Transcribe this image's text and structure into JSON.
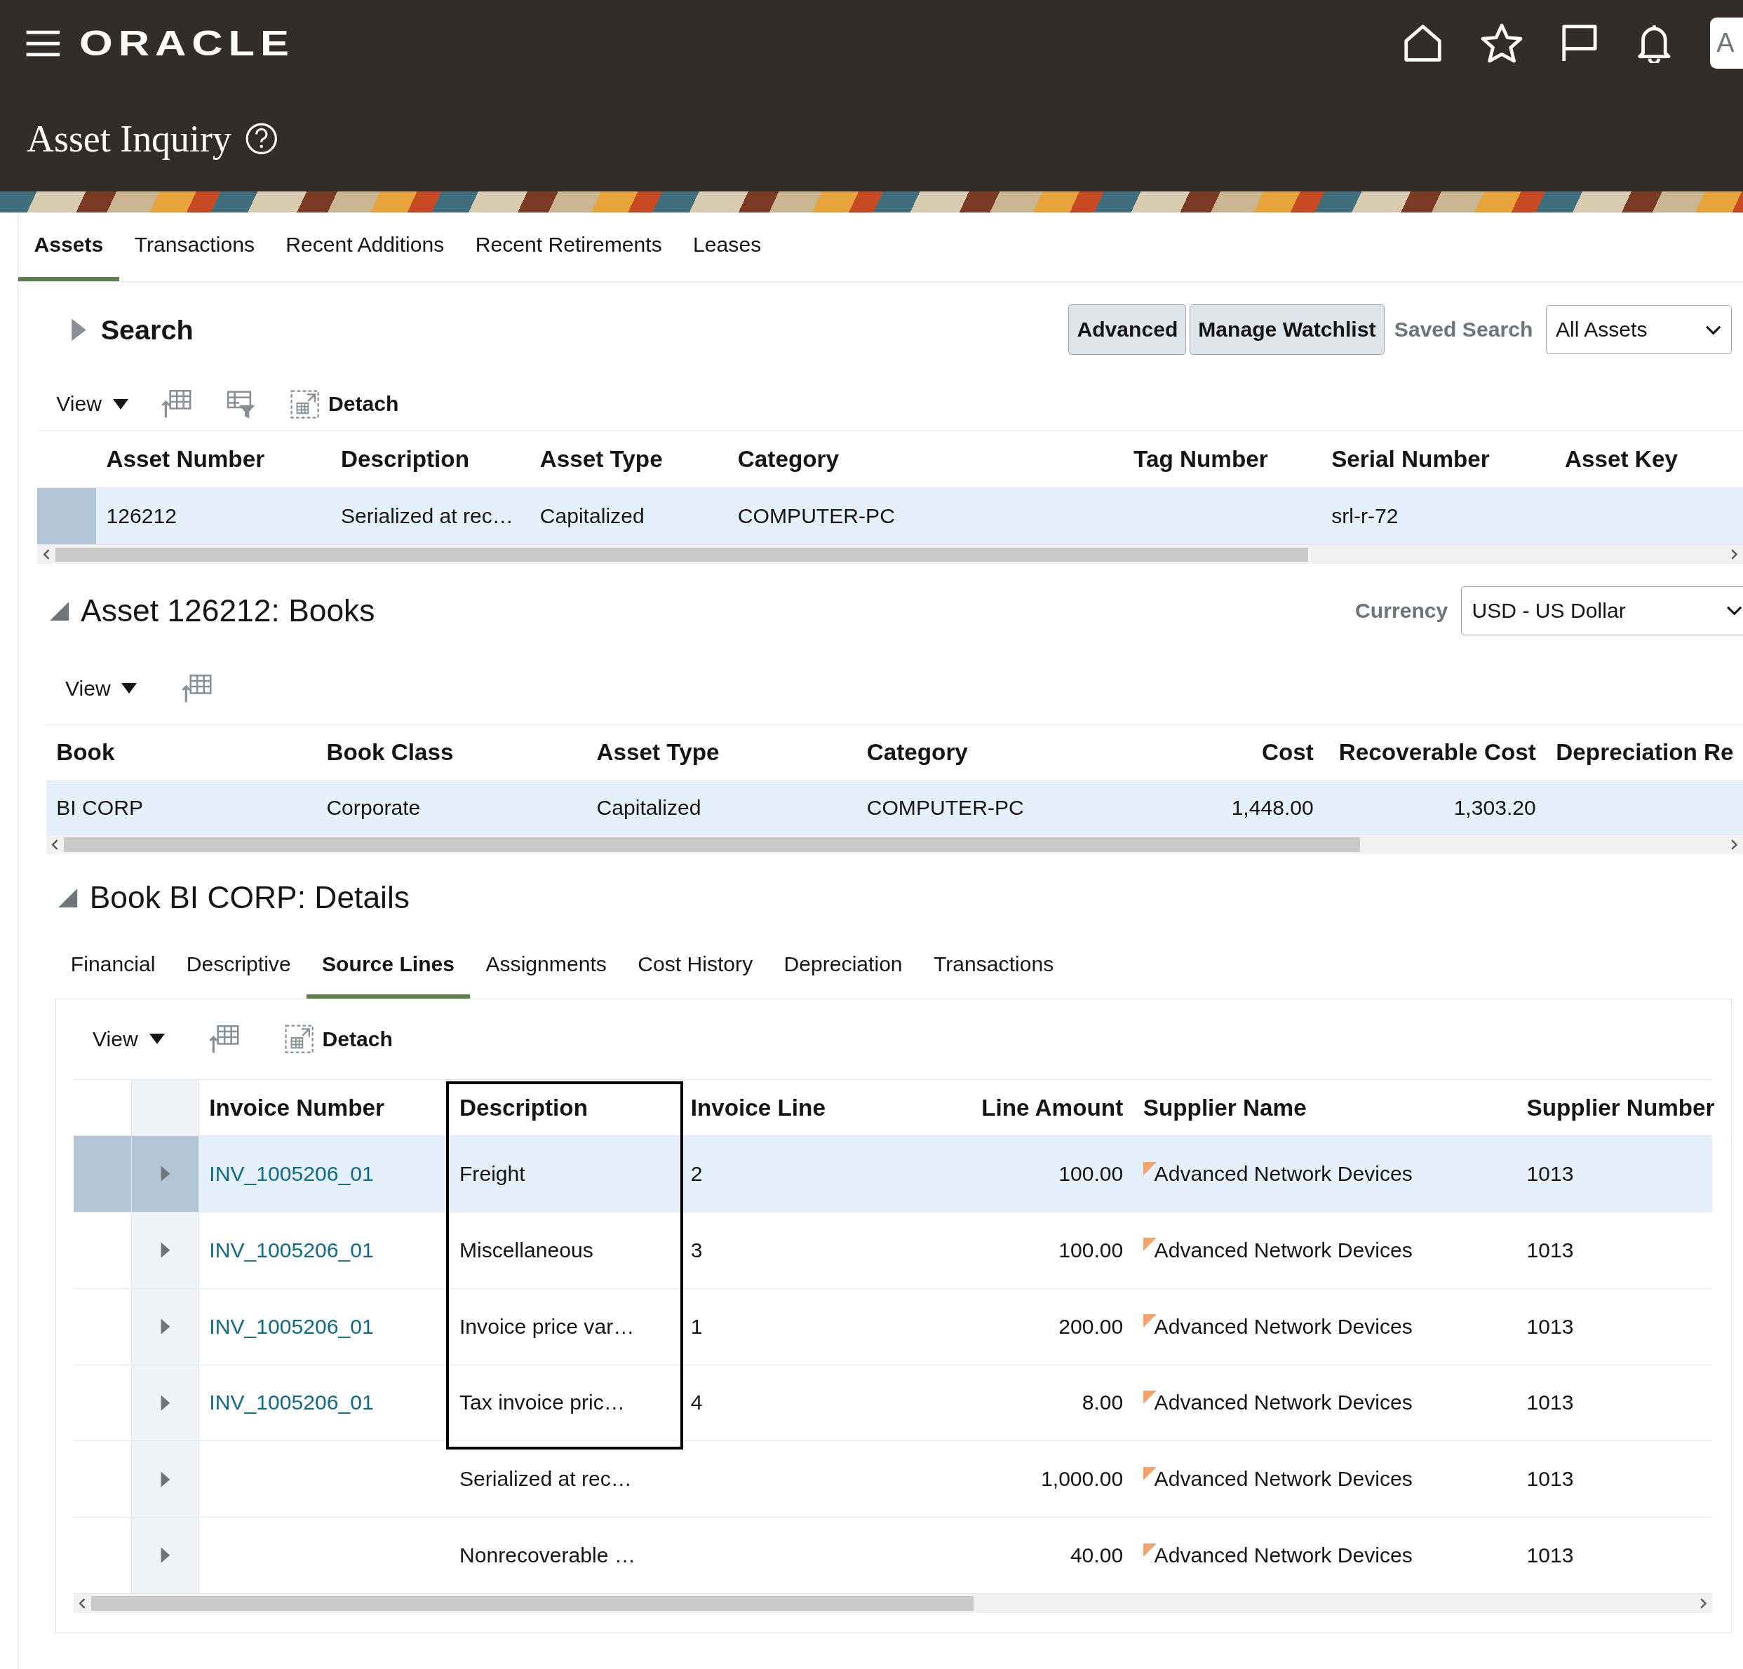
{
  "header": {
    "brand": "ORACLE",
    "avatar": "A",
    "title": "Asset Inquiry"
  },
  "tabs": [
    {
      "label": "Assets",
      "selected": true
    },
    {
      "label": "Transactions",
      "selected": false
    },
    {
      "label": "Recent Additions",
      "selected": false
    },
    {
      "label": "Recent Retirements",
      "selected": false
    },
    {
      "label": "Leases",
      "selected": false
    }
  ],
  "search": {
    "title": "Search",
    "expanded": false,
    "buttons": [
      "Advanced",
      "Manage Watchlist"
    ],
    "saved_search": {
      "label": "Saved Search",
      "value": "All Assets"
    }
  },
  "assets_toolbar": {
    "view": "View",
    "detach": "Detach"
  },
  "assets_table": {
    "columns": [
      "Asset Number",
      "Description",
      "Asset Type",
      "Category",
      "Tag Number",
      "Serial Number",
      "Asset Key"
    ],
    "rows": [
      {
        "selected": true,
        "asset_number": "126212",
        "description": "Serialized at rec…",
        "asset_type": "Capitalized",
        "category": "COMPUTER-PC",
        "serial_number": "srl-r-72"
      }
    ]
  },
  "books": {
    "title": "Asset 126212: Books",
    "expanded": true,
    "currency": {
      "label": "Currency",
      "value": "USD - US Dollar"
    },
    "view": "View",
    "columns": [
      "Book",
      "Book Class",
      "Asset Type",
      "Category",
      "Cost",
      "Recoverable Cost",
      "Depreciation Re"
    ],
    "rows": [
      {
        "selected": true,
        "book": "BI CORP",
        "book_class": "Corporate",
        "asset_type": "Capitalized",
        "category": "COMPUTER-PC",
        "cost": "1,448.00",
        "recoverable_cost": "1,303.20"
      }
    ]
  },
  "details": {
    "title": "Book BI CORP: Details",
    "expanded": true,
    "tabs": [
      {
        "label": "Financial",
        "selected": false
      },
      {
        "label": "Descriptive",
        "selected": false
      },
      {
        "label": "Source Lines",
        "selected": true
      },
      {
        "label": "Assignments",
        "selected": false
      },
      {
        "label": "Cost History",
        "selected": false
      },
      {
        "label": "Depreciation",
        "selected": false
      },
      {
        "label": "Transactions",
        "selected": false
      }
    ],
    "view": "View",
    "detach": "Detach",
    "columns": [
      {
        "label": "Invoice Number",
        "outlined": false
      },
      {
        "label": "Description",
        "outlined": true
      },
      {
        "label": "Invoice Line",
        "outlined": false
      },
      {
        "label": "Line Amount",
        "outlined": false
      },
      {
        "label": "Supplier Name",
        "outlined": false
      },
      {
        "label": "Supplier Number",
        "outlined": false
      }
    ],
    "rows": [
      {
        "selected": true,
        "outlined": true,
        "invoice_number": "INV_1005206_01",
        "description": "Freight",
        "invoice_line": "2",
        "line_amount": "100.00",
        "supplier_name": "Advanced Network Devices",
        "supplier_number": "1013"
      },
      {
        "selected": false,
        "outlined": true,
        "invoice_number": "INV_1005206_01",
        "description": "Miscellaneous",
        "invoice_line": "3",
        "line_amount": "100.00",
        "supplier_name": "Advanced Network Devices",
        "supplier_number": "1013"
      },
      {
        "selected": false,
        "outlined": true,
        "invoice_number": "INV_1005206_01",
        "description": "Invoice price var…",
        "invoice_line": "1",
        "line_amount": "200.00",
        "supplier_name": "Advanced Network Devices",
        "supplier_number": "1013"
      },
      {
        "selected": false,
        "outlined": true,
        "invoice_number": "INV_1005206_01",
        "description": "Tax invoice pric…",
        "invoice_line": "4",
        "line_amount": "8.00",
        "supplier_name": "Advanced Network Devices",
        "supplier_number": "1013"
      },
      {
        "selected": false,
        "outlined": false,
        "description": "Serialized at rec…",
        "line_amount": "1,000.00",
        "supplier_name": "Advanced Network Devices",
        "supplier_number": "1013"
      },
      {
        "selected": false,
        "outlined": false,
        "description": "Nonrecoverable …",
        "line_amount": "40.00",
        "supplier_name": "Advanced Network Devices",
        "supplier_number": "1013"
      }
    ]
  }
}
